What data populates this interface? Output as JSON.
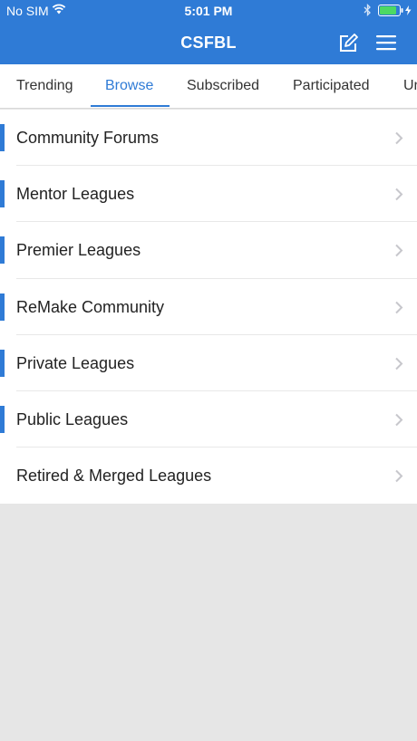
{
  "status_bar": {
    "carrier": "No SIM",
    "time": "5:01 PM",
    "icons": [
      "wifi-icon",
      "bluetooth-icon",
      "battery-charging-icon"
    ]
  },
  "header": {
    "title": "CSFBL",
    "actions": [
      "compose-icon",
      "menu-icon"
    ]
  },
  "tabs": [
    {
      "label": "Trending",
      "active": false
    },
    {
      "label": "Browse",
      "active": true
    },
    {
      "label": "Subscribed",
      "active": false
    },
    {
      "label": "Participated",
      "active": false
    },
    {
      "label": "Un",
      "active": false
    }
  ],
  "forums": [
    {
      "label": "Community Forums",
      "accent": true
    },
    {
      "label": "Mentor Leagues",
      "accent": true
    },
    {
      "label": "Premier Leagues",
      "accent": true
    },
    {
      "label": "ReMake Community",
      "accent": true
    },
    {
      "label": "Private Leagues",
      "accent": true
    },
    {
      "label": "Public Leagues",
      "accent": true
    },
    {
      "label": "Retired & Merged Leagues",
      "accent": false
    }
  ],
  "colors": {
    "brand": "#2f7bd6",
    "background": "#e6e6e6",
    "battery": "#4cd964"
  }
}
